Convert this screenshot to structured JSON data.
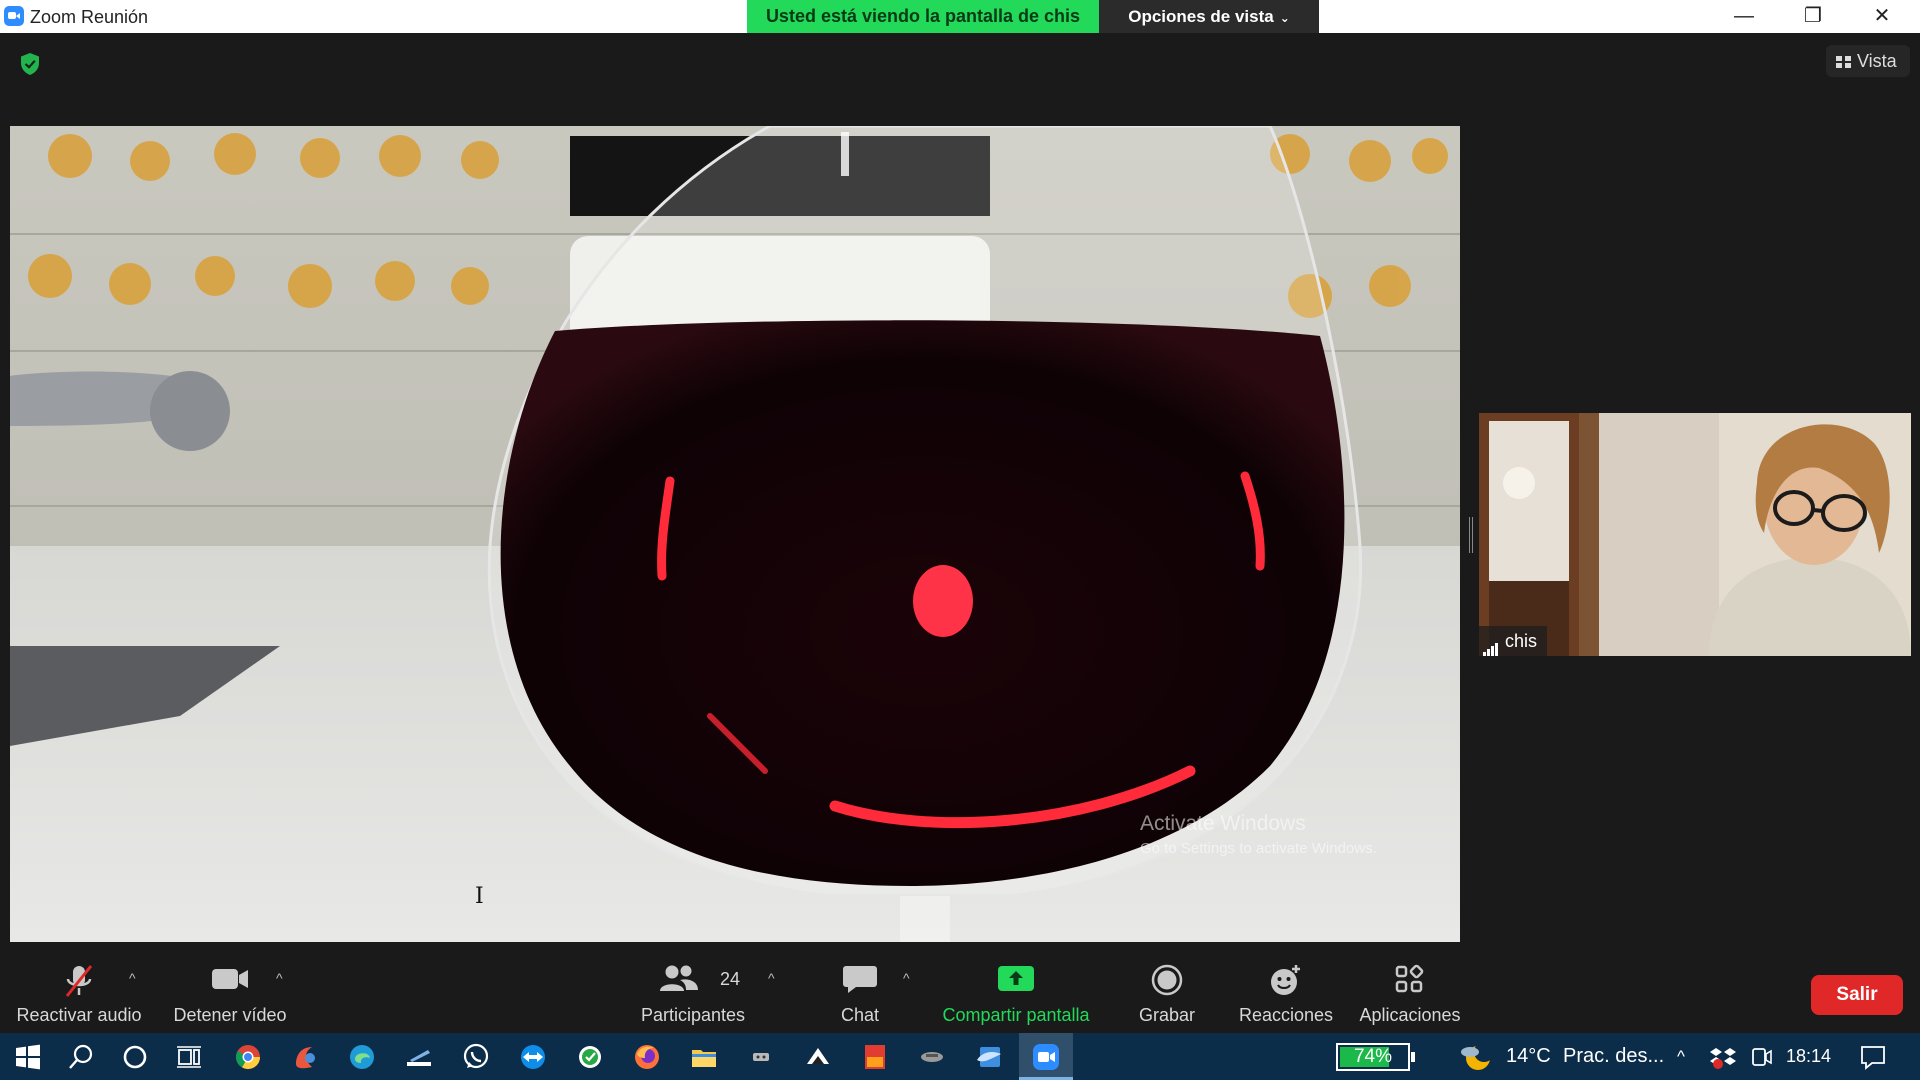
{
  "window": {
    "title": "Zoom Reunión",
    "share_banner": "Usted está viendo la pantalla de chis",
    "view_options": "Opciones de vista",
    "minimize_glyph": "—",
    "restore_glyph": "❐",
    "close_glyph": "✕"
  },
  "stage": {
    "vista_button": "Vista",
    "watermark_line1": "Activate Windows",
    "watermark_line2": "Go to Settings to activate Windows.",
    "cursor_glyph": "I"
  },
  "participant": {
    "name": "chis"
  },
  "toolbar": {
    "audio_label": "Reactivar audio",
    "video_label": "Detener vídeo",
    "participants_label": "Participantes",
    "participants_count": "24",
    "chat_label": "Chat",
    "share_label": "Compartir pantalla",
    "record_label": "Grabar",
    "reactions_label": "Reacciones",
    "apps_label": "Aplicaciones",
    "caret_glyph": "^",
    "leave_label": "Salir"
  },
  "taskbar": {
    "battery_percent": 74,
    "battery_label": "74%",
    "weather_temp": "14°C",
    "weather_text": "Prac. des...",
    "tray_chevron": "^",
    "time": "18:14",
    "icons": [
      "windows-start",
      "search",
      "cortana",
      "task-view",
      "chrome",
      "app-paint",
      "edge",
      "notes-app",
      "whatsapp",
      "teamviewer",
      "app-green",
      "firefox",
      "file-explorer",
      "app-game",
      "app-mountain",
      "pdf-jpg",
      "app-misc",
      "outlook",
      "zoom"
    ]
  },
  "colors": {
    "share_green": "#23d959",
    "leave_red": "#e02828",
    "taskbar_blue": "#0b2d4a",
    "zoom_blue": "#2d8cff"
  }
}
